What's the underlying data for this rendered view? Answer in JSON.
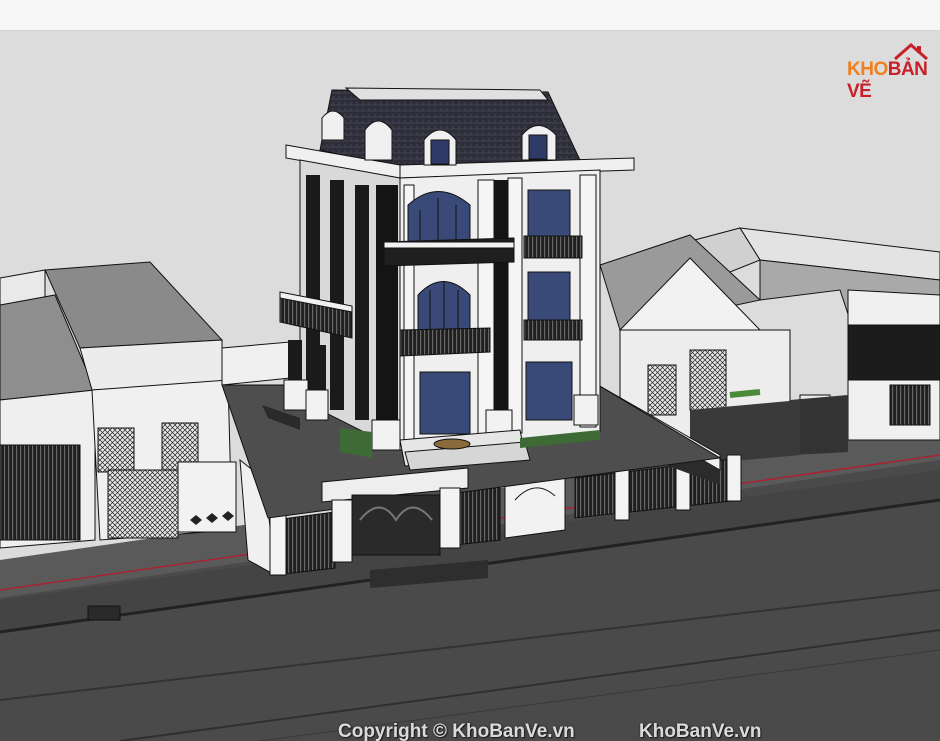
{
  "logo": {
    "part1": "KHO",
    "part2": "BẢN VẼ",
    "colors": {
      "orange": "#f0801e",
      "red": "#c8202a"
    }
  },
  "watermarks": {
    "left": "Copyright © KhoBanVe.vn",
    "right": "KhoBanVe.vn"
  },
  "scene": {
    "background": "#dcdcdc",
    "road_color": "#484848",
    "wall_color": "#ededed",
    "roof_color": "#2e2e3a",
    "window_color": "#3a4a78"
  }
}
